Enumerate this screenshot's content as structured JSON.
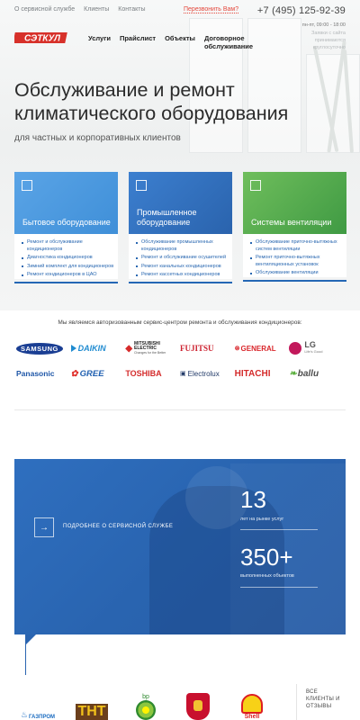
{
  "topbar": {
    "links": [
      "О сервисной службе",
      "Клиенты",
      "Контакты"
    ],
    "callback": "Перезвонить Вам?",
    "phone": "+7 (495) 125-92-39",
    "hours": "пн-пт, 09:00 - 18:00",
    "hours_note": "Заявки с сайта принимаются круглосуточно"
  },
  "brand": {
    "logo_text": "СЭТКУЛ",
    "logo_color": "#d7312a"
  },
  "mainnav": [
    "Услуги",
    "Прайслист",
    "Объекты",
    "Договорное обслуживание"
  ],
  "hero": {
    "title": "Обслуживание и ремонт климатического оборудования",
    "subtitle": "для частных и корпоративных клиентов"
  },
  "cards": [
    {
      "title": "Бытовое оборудование",
      "color": "#3f8fd8",
      "icon": "split-ac-icon",
      "items": [
        "Ремонт и обслуживание кондиционеров",
        "Диагностика кондиционеров",
        "Зимний комплект для кондиционеров",
        "Ремонт кондиционеров в ЦАО"
      ]
    },
    {
      "title": "Промышленное оборудование",
      "color": "#2f6fc0",
      "icon": "industrial-unit-icon",
      "items": [
        "Обслуживание промышленных кондиционеров",
        "Ремонт и обслуживание осушителей",
        "Ремонт канальных кондиционеров",
        "Ремонт кассетных кондиционеров"
      ]
    },
    {
      "title": "Системы вентиляции",
      "color": "#4ea84a",
      "icon": "ventilation-icon",
      "items": [
        "Обслуживание приточно-вытяжных систем вентиляции",
        "Ремонт приточно-вытяжных вентиляционных установок",
        "Обслуживание вентиляции"
      ]
    }
  ],
  "authorized": {
    "text": "Мы являемся авторизованным сервис-центром ремонта и обслуживания кондиционеров:",
    "brands": [
      "SAMSUNG",
      "DAIKIN",
      "MITSUBISHI ELECTRIC",
      "FUJITSU",
      "GENERAL",
      "LG",
      "Panasonic",
      "GREE",
      "TOSHIBA",
      "Electrolux",
      "HITACHI",
      "ballu"
    ],
    "brand_sublabels": {
      "mitsubishi": "Changes for the Better",
      "lg": "Life's Good"
    }
  },
  "promo": {
    "more_label": "ПОДРОБНЕЕ О СЕРВИСНОЙ СЛУЖБЕ",
    "stats": [
      {
        "value": "13",
        "label": "лет на рынке услуг"
      },
      {
        "value": "350+",
        "label": "выполненных объектов"
      }
    ]
  },
  "clients": {
    "logos": [
      "Газпром",
      "ТНТ",
      "bp",
      "Герб России",
      "Shell"
    ],
    "gazprom_text": "ГАЗПРОМ",
    "bp_text": "bp",
    "all_label": "ВСЕ КЛИЕНТЫ И ОТЗЫВЫ"
  },
  "colors": {
    "accent_blue": "#2a68b1",
    "callback_red": "#e4483c",
    "promo_blue": "#2b66b2"
  }
}
